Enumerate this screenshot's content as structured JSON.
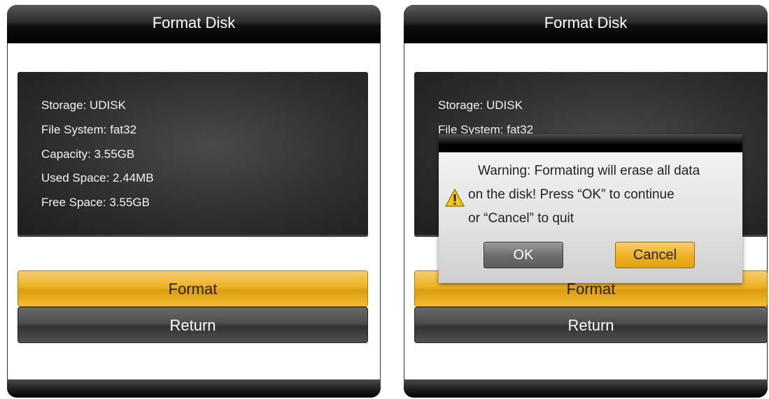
{
  "left": {
    "title": "Format Disk",
    "info": {
      "storage": "Storage: UDISK",
      "file_system": "File System: fat32",
      "capacity": "Capacity: 3.55GB",
      "used": "Used Space: 2.44MB",
      "free": "Free Space: 3.55GB"
    },
    "buttons": {
      "format": "Format",
      "return": "Return"
    }
  },
  "right": {
    "title": "Format Disk",
    "info": {
      "storage": "Storage: UDISK",
      "file_system": "File System: fat32"
    },
    "buttons": {
      "format": "Format",
      "return": "Return"
    },
    "dialog": {
      "line1": "Warning: Formating will erase all data",
      "line2": "on the disk! Press “OK” to continue",
      "line3": "or “Cancel” to quit",
      "ok": "OK",
      "cancel": "Cancel",
      "icon": "warning-icon"
    }
  },
  "colors": {
    "accent": "#eeb224",
    "panel": "#2f2f2f",
    "titlebar": "#1a1a1a"
  }
}
